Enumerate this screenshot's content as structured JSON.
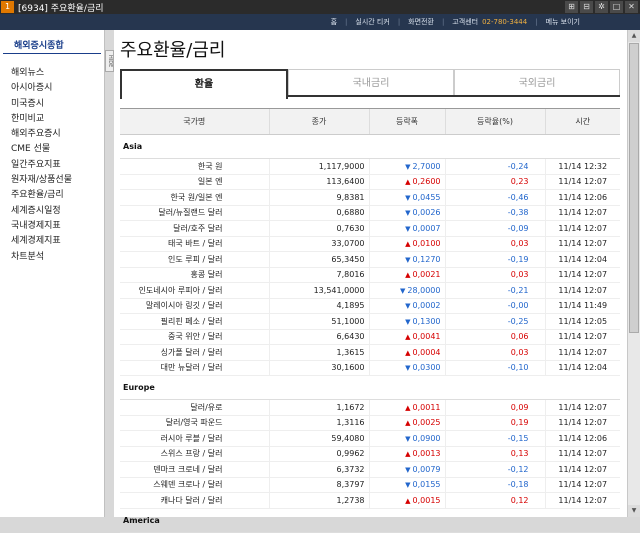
{
  "window": {
    "number": "1",
    "title": "[6934] 주요환율/금리",
    "icons": [
      "⊞",
      "⊟",
      "✲",
      "□",
      "✕"
    ]
  },
  "topnav": {
    "items": [
      "홈",
      "실시간 티커",
      "화면전환",
      "고객센터"
    ],
    "phone": "02-780-3444",
    "menu": "메뉴 보이기"
  },
  "sidebar": {
    "header": "해외증시종합",
    "items": [
      "해외뉴스",
      "아시아증시",
      "미국증시",
      "한미비교",
      "해외주요증시",
      "CME 선물",
      "일간주요지표",
      "원자재/상품선물",
      "주요환율/금리",
      "세계증시일정",
      "국내경제지표",
      "세계경제지표",
      "차트분석"
    ],
    "collapse_label": "HIDE"
  },
  "page": {
    "title": "주요환율/금리"
  },
  "tabs": [
    "환율",
    "국내금리",
    "국외금리"
  ],
  "columns": [
    "국가명",
    "종가",
    "등락폭",
    "등락율(%)",
    "시간"
  ],
  "colors": {
    "up": "#d60000",
    "down": "#2266cc",
    "accent": "#1a3e8a"
  },
  "regions": [
    {
      "name": "Asia",
      "rows": [
        {
          "name": "한국 원",
          "price": "1,117,9000",
          "dir": "dn",
          "chg": "2,7000",
          "pct": "-0,24",
          "time": "11/14 12:32"
        },
        {
          "name": "일본 엔",
          "price": "113,6400",
          "dir": "up",
          "chg": "0,2600",
          "pct": "0,23",
          "time": "11/14 12:07"
        },
        {
          "name": "한국 원/일본 엔",
          "price": "9,8381",
          "dir": "dn",
          "chg": "0,0455",
          "pct": "-0,46",
          "time": "11/14 12:06"
        },
        {
          "name": "달러/뉴질랜드 달러",
          "price": "0,6880",
          "dir": "dn",
          "chg": "0,0026",
          "pct": "-0,38",
          "time": "11/14 12:07"
        },
        {
          "name": "달러/호주 달러",
          "price": "0,7630",
          "dir": "dn",
          "chg": "0,0007",
          "pct": "-0,09",
          "time": "11/14 12:07"
        },
        {
          "name": "태국 바트 / 달러",
          "price": "33,0700",
          "dir": "up",
          "chg": "0,0100",
          "pct": "0,03",
          "time": "11/14 12:07"
        },
        {
          "name": "인도 루피 / 달러",
          "price": "65,3450",
          "dir": "dn",
          "chg": "0,1270",
          "pct": "-0,19",
          "time": "11/14 12:04"
        },
        {
          "name": "홍콩 달러",
          "price": "7,8016",
          "dir": "up",
          "chg": "0,0021",
          "pct": "0,03",
          "time": "11/14 12:07"
        },
        {
          "name": "인도네시아 루피아 / 달러",
          "price": "13,541,0000",
          "dir": "dn",
          "chg": "28,0000",
          "pct": "-0,21",
          "time": "11/14 12:07"
        },
        {
          "name": "말레이시아 링깃 / 달러",
          "price": "4,1895",
          "dir": "dn",
          "chg": "0,0002",
          "pct": "-0,00",
          "time": "11/14 11:49"
        },
        {
          "name": "필리핀 페소 / 달러",
          "price": "51,1000",
          "dir": "dn",
          "chg": "0,1300",
          "pct": "-0,25",
          "time": "11/14 12:05"
        },
        {
          "name": "중국 위안 / 달러",
          "price": "6,6430",
          "dir": "up",
          "chg": "0,0041",
          "pct": "0,06",
          "time": "11/14 12:07"
        },
        {
          "name": "싱가폴 달러 / 달러",
          "price": "1,3615",
          "dir": "up",
          "chg": "0,0004",
          "pct": "0,03",
          "time": "11/14 12:07"
        },
        {
          "name": "대만 뉴달러 / 달러",
          "price": "30,1600",
          "dir": "dn",
          "chg": "0,0300",
          "pct": "-0,10",
          "time": "11/14 12:04"
        }
      ]
    },
    {
      "name": "Europe",
      "rows": [
        {
          "name": "달러/유로",
          "price": "1,1672",
          "dir": "up",
          "chg": "0,0011",
          "pct": "0,09",
          "time": "11/14 12:07"
        },
        {
          "name": "달러/영국 파운드",
          "price": "1,3116",
          "dir": "up",
          "chg": "0,0025",
          "pct": "0,19",
          "time": "11/14 12:07"
        },
        {
          "name": "러시아 루블 / 달러",
          "price": "59,4080",
          "dir": "dn",
          "chg": "0,0900",
          "pct": "-0,15",
          "time": "11/14 12:06"
        },
        {
          "name": "스위스 프랑 / 달러",
          "price": "0,9962",
          "dir": "up",
          "chg": "0,0013",
          "pct": "0,13",
          "time": "11/14 12:07"
        },
        {
          "name": "덴마크 크로네 / 달러",
          "price": "6,3732",
          "dir": "dn",
          "chg": "0,0079",
          "pct": "-0,12",
          "time": "11/14 12:07"
        },
        {
          "name": "스웨덴 크로나 / 달러",
          "price": "8,3797",
          "dir": "dn",
          "chg": "0,0155",
          "pct": "-0,18",
          "time": "11/14 12:07"
        },
        {
          "name": "캐나다 달러 / 달러",
          "price": "1,2738",
          "dir": "up",
          "chg": "0,0015",
          "pct": "0,12",
          "time": "11/14 12:07"
        }
      ]
    },
    {
      "name": "America",
      "rows": []
    }
  ]
}
